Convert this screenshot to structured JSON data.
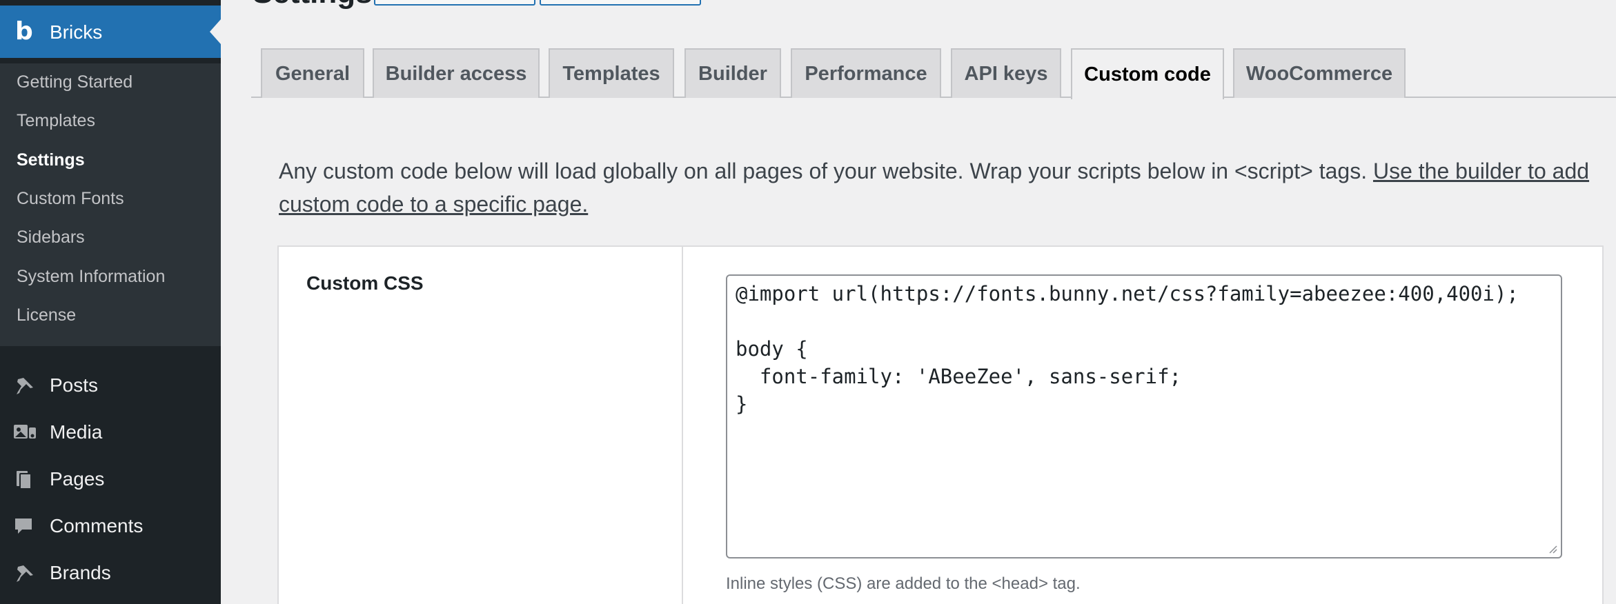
{
  "sidebar": {
    "brand": {
      "logo_letter": "b",
      "label": "Bricks"
    },
    "submenu": [
      {
        "label": "Getting Started",
        "active": false
      },
      {
        "label": "Templates",
        "active": false
      },
      {
        "label": "Settings",
        "active": true
      },
      {
        "label": "Custom Fonts",
        "active": false
      },
      {
        "label": "Sidebars",
        "active": false
      },
      {
        "label": "System Information",
        "active": false
      },
      {
        "label": "License",
        "active": false
      }
    ],
    "main": [
      {
        "label": "Posts",
        "icon": "pushpin-icon"
      },
      {
        "label": "Media",
        "icon": "media-icon"
      },
      {
        "label": "Pages",
        "icon": "pages-icon"
      },
      {
        "label": "Comments",
        "icon": "comment-icon"
      },
      {
        "label": "Brands",
        "icon": "pushpin-icon"
      }
    ]
  },
  "header": {
    "title": "Settings"
  },
  "tabs": [
    {
      "label": "General",
      "active": false
    },
    {
      "label": "Builder access",
      "active": false
    },
    {
      "label": "Templates",
      "active": false
    },
    {
      "label": "Builder",
      "active": false
    },
    {
      "label": "Performance",
      "active": false
    },
    {
      "label": "API keys",
      "active": false
    },
    {
      "label": "Custom code",
      "active": true
    },
    {
      "label": "WooCommerce",
      "active": false
    }
  ],
  "intro": {
    "text": "Any custom code below will load globally on all pages of your website. Wrap your scripts below in <script> tags. ",
    "link": "Use the builder to add custom code to a specific page."
  },
  "custom_css": {
    "label": "Custom CSS",
    "value": "@import url(https://fonts.bunny.net/css?family=abeezee:400,400i);\n\nbody {\n  font-family: 'ABeeZee', sans-serif;\n}",
    "description": "Inline styles (CSS) are added to the <head> tag."
  },
  "colors": {
    "sidebar_bg": "#1d2327",
    "submenu_bg": "#2c3338",
    "accent": "#2271b1",
    "page_bg": "#f0f0f1"
  }
}
